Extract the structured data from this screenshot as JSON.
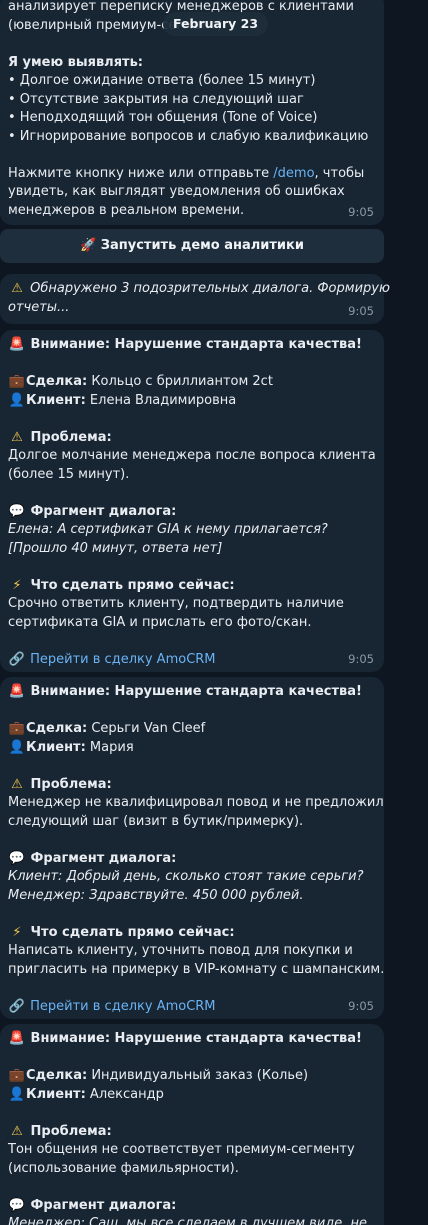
{
  "date": "February 23",
  "intro": {
    "lines": [
      "анализирует переписку менеджеров с клиентами",
      "(ювелирный премиум-сегмент)."
    ],
    "skills_title": "Я умею выявлять:",
    "skills": [
      "• Долгое ожидание ответа (более 15 минут)",
      "• Отсутствие закрытия на следующий шаг",
      "• Неподходящий тон общения (Tone of Voice)",
      "• Игнорирование вопросов и слабую квалификацию"
    ],
    "cta_pre": "Нажмите кнопку ниже или отправьте ",
    "cta_cmd": "/demo",
    "cta_post": ", чтобы",
    "cta_line2": "увидеть, как выглядят уведомления об ошибках",
    "cta_line3": "менеджеров в реальном времени.",
    "time": "9:05"
  },
  "demo_button": {
    "label": "Запустить демо аналитики"
  },
  "status_msg": {
    "line1": "Обнаружено 3 подозрительных диалога. Формирую",
    "line2": "отчеты...",
    "time": "9:05"
  },
  "alerts": [
    {
      "title": "Внимание: Нарушение стандарта качества!",
      "deal_label": "Сделка:",
      "deal": " Кольцо с бриллиантом 2ct",
      "client_label": "Клиент:",
      "client": " Елена Владимировна",
      "problem_label": "Проблема:",
      "problem": [
        "Долгое молчание менеджера после вопроса клиента",
        "(более 15 минут)."
      ],
      "fragment_label": "Фрагмент диалога:",
      "fragment": [
        "Елена: А сертификат GIA к нему прилагается?",
        "[Прошло 40 минут, ответа нет]"
      ],
      "action_label": "Что сделать прямо сейчас:",
      "action": [
        "Срочно ответить клиенту, подтвердить наличие",
        "сертификата GIA и прислать его фото/скан."
      ],
      "link": "Перейти в сделку AmoCRM",
      "time": "9:05"
    },
    {
      "title": "Внимание: Нарушение стандарта качества!",
      "deal_label": "Сделка:",
      "deal": " Серьги Van Cleef",
      "client_label": "Клиент:",
      "client": " Мария",
      "problem_label": "Проблема:",
      "problem": [
        "Менеджер не квалифицировал повод и не предложил",
        "следующий шаг (визит в бутик/примерку)."
      ],
      "fragment_label": "Фрагмент диалога:",
      "fragment": [
        "Клиент: Добрый день, сколько стоят такие серьги?",
        "Менеджер: Здравствуйте. 450 000 рублей."
      ],
      "action_label": "Что сделать прямо сейчас:",
      "action": [
        "Написать клиенту, уточнить повод для покупки и",
        "пригласить на примерку в VIP-комнату с шампанским."
      ],
      "link": "Перейти в сделку AmoCRM",
      "time": "9:05"
    },
    {
      "title": "Внимание: Нарушение стандарта качества!",
      "deal_label": "Сделка:",
      "deal": " Индивидуальный заказ (Колье)",
      "client_label": "Клиент:",
      "client": " Александр",
      "problem_label": "Проблема:",
      "problem": [
        "Тон общения не соответствует премиум-сегменту",
        "(использование фамильярности)."
      ],
      "fragment_label": "Фрагмент диалога:",
      "fragment": [
        "Менеджер: Саш, мы все сделаем в лучшем виде, не"
      ]
    }
  ]
}
